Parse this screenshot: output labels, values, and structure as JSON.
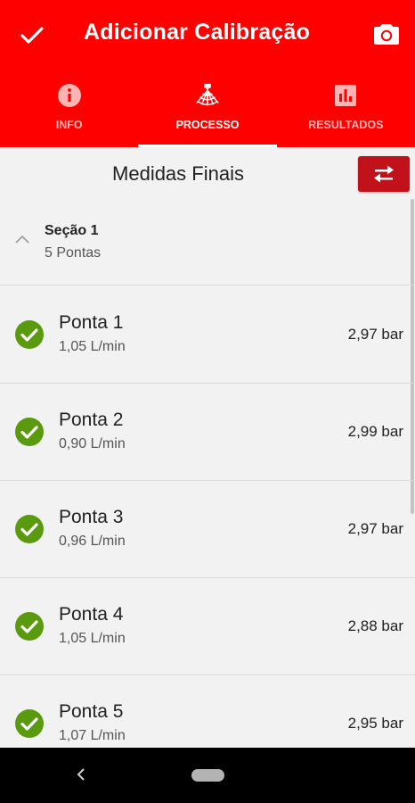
{
  "app_bar": {
    "title": "Adicionar Calibração",
    "confirm_icon": "check-icon",
    "camera_icon": "camera-icon",
    "background": "#ff0000"
  },
  "tabs": [
    {
      "label": "INFO",
      "icon": "info-icon",
      "active": false
    },
    {
      "label": "PROCESSO",
      "icon": "spray-nozzle-icon",
      "active": true
    },
    {
      "label": "RESULTADOS",
      "icon": "bar-chart-icon",
      "active": false
    }
  ],
  "content": {
    "title": "Medidas Finais",
    "swap_icon": "swap-icon",
    "section": {
      "name": "Seção 1",
      "count": "5 Pontas",
      "expanded": true
    },
    "nozzles": [
      {
        "name": "Ponta 1",
        "flow": "1,05 L/min",
        "pressure": "2,97 bar",
        "status": "ok"
      },
      {
        "name": "Ponta 2",
        "flow": "0,90 L/min",
        "pressure": "2,99 bar",
        "status": "ok"
      },
      {
        "name": "Ponta 3",
        "flow": "0,96 L/min",
        "pressure": "2,97 bar",
        "status": "ok"
      },
      {
        "name": "Ponta 4",
        "flow": "1,05 L/min",
        "pressure": "2,88 bar",
        "status": "ok"
      },
      {
        "name": "Ponta 5",
        "flow": "1,07 L/min",
        "pressure": "2,95 bar",
        "status": "ok"
      }
    ]
  },
  "colors": {
    "accent": "#ff0000",
    "swap_button": "#c1121c",
    "status_ok": "#5a9a0f"
  },
  "system_nav": {
    "back_icon": "back-icon",
    "home_icon": "home-pill-icon"
  }
}
